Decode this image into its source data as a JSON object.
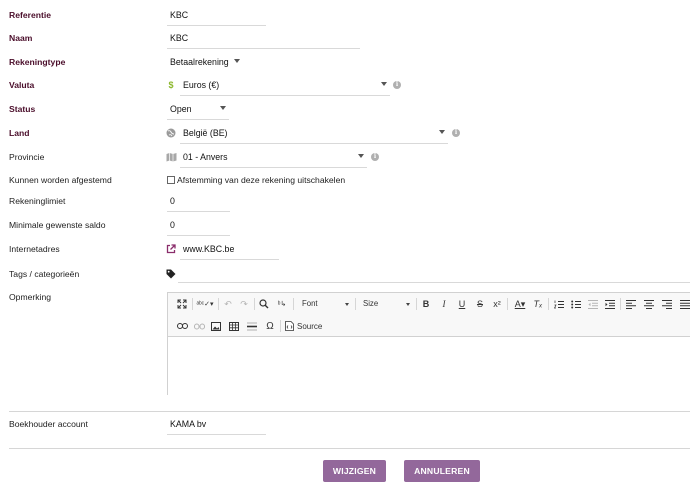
{
  "fields": {
    "referentie": {
      "label": "Referentie",
      "value": "KBC"
    },
    "naam": {
      "label": "Naam",
      "value": "KBC"
    },
    "rekeningtype": {
      "label": "Rekeningtype",
      "value": "Betaalrekening"
    },
    "valuta": {
      "label": "Valuta",
      "value": "Euros (€)",
      "icon": "dollar-icon"
    },
    "status": {
      "label": "Status",
      "value": "Open"
    },
    "land": {
      "label": "Land",
      "value": "België (BE)",
      "icon": "globe-icon"
    },
    "provincie": {
      "label": "Provincie",
      "value": "01 - Anvers",
      "icon": "map-icon"
    },
    "afgestemd": {
      "label": "Kunnen worden afgestemd",
      "checkbox_label": "Afstemming van deze rekening uitschakelen",
      "checked": false
    },
    "rekeninglimiet": {
      "label": "Rekeninglimiet",
      "value": "0"
    },
    "minimale_saldo": {
      "label": "Minimale gewenste saldo",
      "value": "0"
    },
    "internetadres": {
      "label": "Internetadres",
      "value": "www.KBC.be",
      "icon": "external-link-icon"
    },
    "tags": {
      "label": "Tags / categorieën",
      "value": "",
      "icon": "tag-icon"
    },
    "opmerking": {
      "label": "Opmerking"
    },
    "boekhouder": {
      "label": "Boekhouder account",
      "value": "KAMA bv"
    }
  },
  "editor": {
    "font_label": "Font",
    "size_label": "Size",
    "source_label": "Source"
  },
  "buttons": {
    "submit": "WIJZIGEN",
    "cancel": "ANNULEREN"
  },
  "colors": {
    "required_label": "#4a0d2a",
    "button": "#93689b",
    "currency_icon": "#8bb72c",
    "link_icon": "#8a2d6b"
  }
}
